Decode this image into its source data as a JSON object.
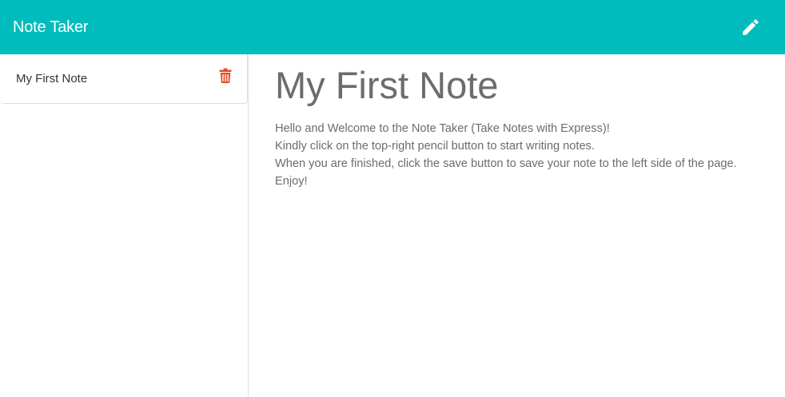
{
  "navbar": {
    "brand": "Note Taker",
    "new_note_icon": "pencil-icon",
    "background_color": "#01bcbd"
  },
  "sidebar": {
    "notes": [
      {
        "title": "My First Note",
        "delete_icon": "trash-icon"
      }
    ],
    "delete_icon_color": "#e54d26"
  },
  "main": {
    "title": "My First Note",
    "body": "Hello and Welcome to the Note Taker (Take Notes with Express)!\nKindly click on the top-right pencil button to start writing notes.\nWhen you are finished, click the save button to save your note to the left side of the page.\nEnjoy!"
  }
}
